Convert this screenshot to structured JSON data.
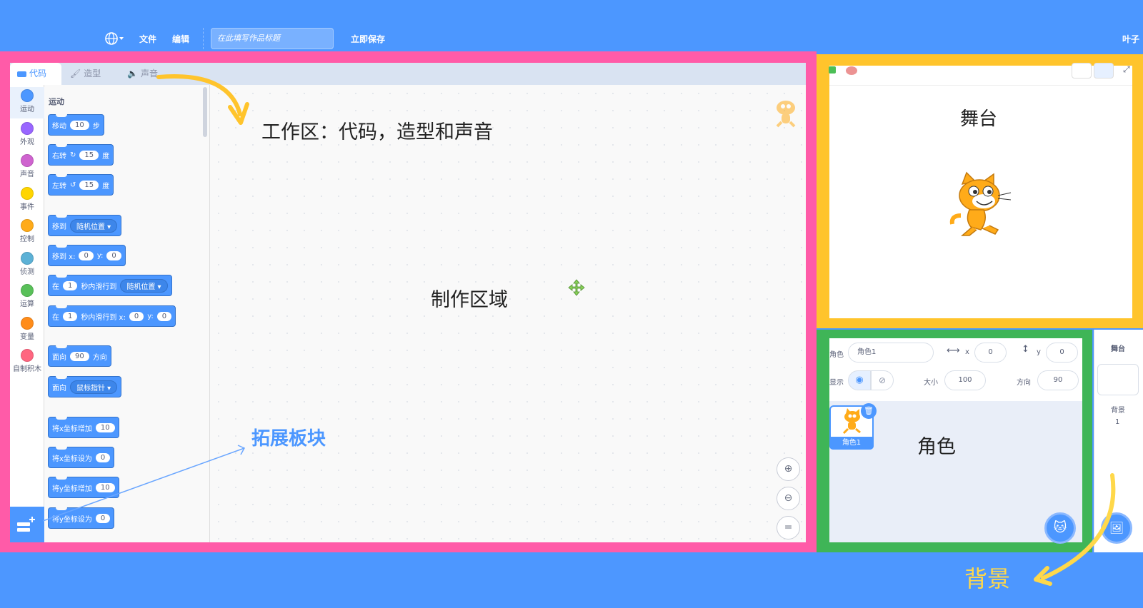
{
  "menubar": {
    "globe_icon": "globe-icon",
    "file": "文件",
    "edit": "编辑",
    "title_placeholder": "在此填写作品标题",
    "save_now": "立即保存",
    "user": "叶子"
  },
  "tabs": {
    "code": "代码",
    "costume": "造型",
    "sound": "声音"
  },
  "categories": [
    {
      "label": "运动",
      "color": "#4c97ff"
    },
    {
      "label": "外观",
      "color": "#9966ff"
    },
    {
      "label": "声音",
      "color": "#cf63cf"
    },
    {
      "label": "事件",
      "color": "#ffd500"
    },
    {
      "label": "控制",
      "color": "#ffab19"
    },
    {
      "label": "侦测",
      "color": "#5cb1d6"
    },
    {
      "label": "运算",
      "color": "#59c059"
    },
    {
      "label": "变量",
      "color": "#ff8c1a"
    },
    {
      "label": "自制积木",
      "color": "#ff6680"
    }
  ],
  "palette": {
    "title": "运动",
    "blocks": {
      "move": {
        "t1": "移动",
        "v": "10",
        "t2": "步"
      },
      "turn_right": {
        "t1": "右转",
        "v": "15",
        "t2": "度"
      },
      "turn_left": {
        "t1": "左转",
        "v": "15",
        "t2": "度"
      },
      "goto": {
        "t1": "移到",
        "drop": "随机位置"
      },
      "goto_xy": {
        "t1": "移到 x:",
        "x": "0",
        "t2": "y:",
        "y": "0"
      },
      "glide": {
        "t1": "在",
        "v": "1",
        "t2": "秒内滑行到",
        "drop": "随机位置"
      },
      "glide_xy": {
        "t1": "在",
        "v": "1",
        "t2": "秒内滑行到 x:",
        "x": "0",
        "t3": "y:",
        "y": "0"
      },
      "point_dir": {
        "t1": "面向",
        "v": "90",
        "t2": "方向"
      },
      "point_towards": {
        "t1": "面向",
        "drop": "鼠标指针"
      },
      "change_x": {
        "t1": "将x坐标增加",
        "v": "10"
      },
      "set_x": {
        "t1": "将x坐标设为",
        "v": "0"
      },
      "change_y": {
        "t1": "将y坐标增加",
        "v": "10"
      },
      "set_y": {
        "t1": "将y坐标设为",
        "v": "0"
      }
    }
  },
  "annotations": {
    "workspace_tabs": "工作区：代码，造型和声音",
    "make_area": "制作区域",
    "extension": "拓展板块",
    "stage": "舞台",
    "sprite": "角色",
    "backdrop": "背景"
  },
  "sprite_info": {
    "sprite_label": "角色",
    "sprite_name": "角色1",
    "x_label": "x",
    "x": "0",
    "y_label": "y",
    "y": "0",
    "show_label": "显示",
    "size_label": "大小",
    "size": "100",
    "direction_label": "方向",
    "direction": "90"
  },
  "sprite_list": {
    "item": "角色1"
  },
  "backdrop_panel": {
    "title": "舞台",
    "bg_label": "背景",
    "bg_count": "1"
  },
  "colors": {
    "frame_pink": "#ff5ba8",
    "frame_yellow": "#ffc42c",
    "frame_green": "#3fb557",
    "accent": "#4c97ff",
    "arrow_yellow": "#ffc42c"
  }
}
